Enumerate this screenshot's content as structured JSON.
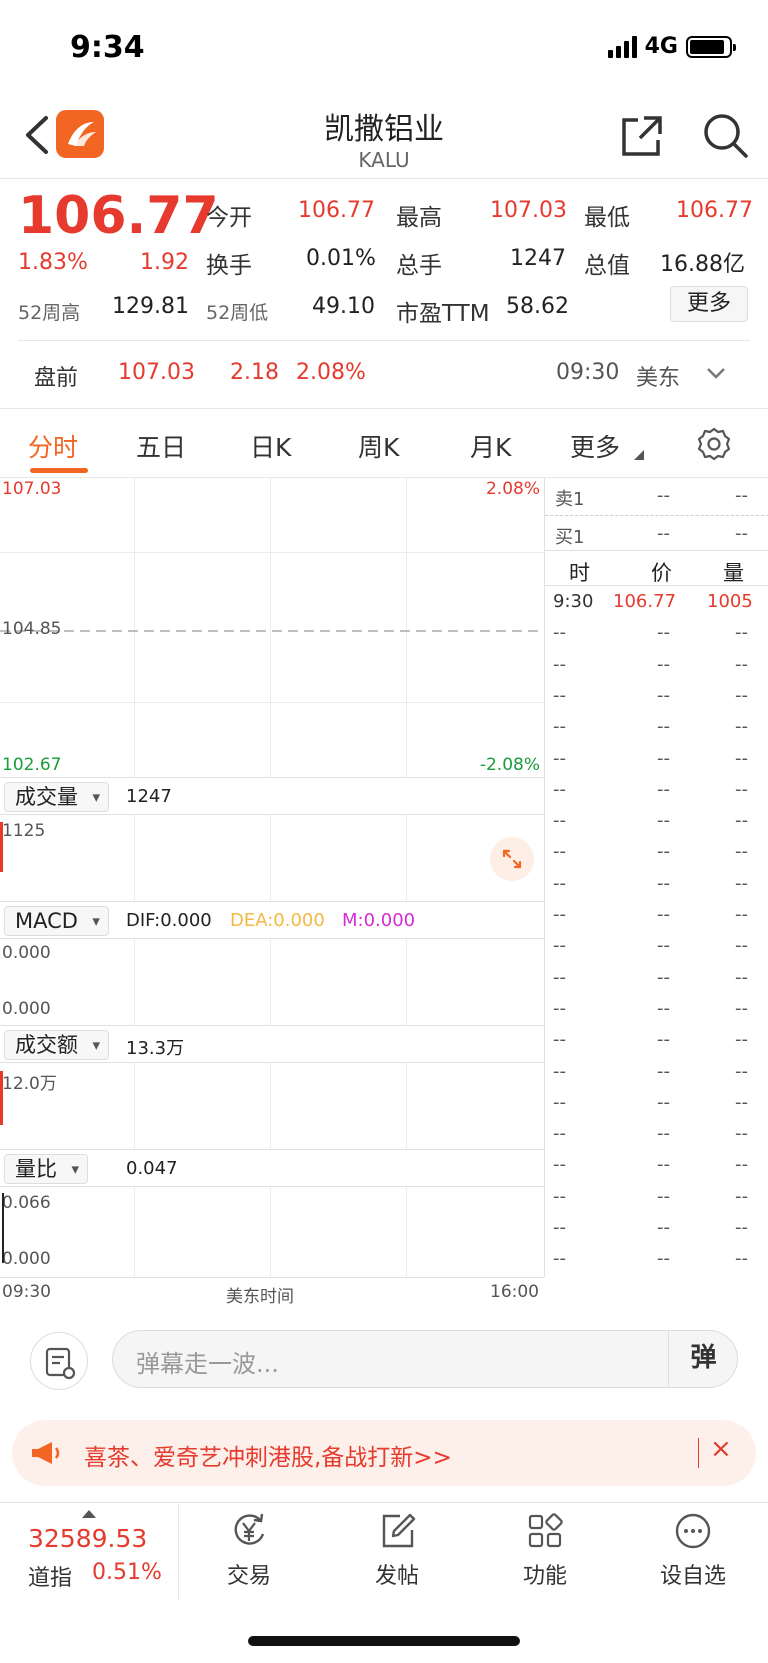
{
  "status": {
    "time": "9:34",
    "network": "4G"
  },
  "header": {
    "title": "凯撒铝业",
    "ticker": "KALU"
  },
  "quote": {
    "price": "106.77",
    "change_pct": "1.83%",
    "change": "1.92",
    "open_label": "今开",
    "open": "106.77",
    "high_label": "最高",
    "high": "107.03",
    "low_label": "最低",
    "low": "106.77",
    "turnover_label": "换手",
    "turnover": "0.01%",
    "volume_label": "总手",
    "volume": "1247",
    "mktcap_label": "总值",
    "mktcap": "16.88亿",
    "w52high_label": "52周高",
    "w52high": "129.81",
    "w52low_label": "52周低",
    "w52low": "49.10",
    "pe_label": "市盈TTM",
    "pe": "58.62",
    "more_label": "更多"
  },
  "premarket": {
    "label": "盘前",
    "price": "107.03",
    "change": "2.18",
    "change_pct": "2.08%",
    "time": "09:30",
    "market": "美东"
  },
  "tabs": [
    {
      "label": "分时",
      "active": true
    },
    {
      "label": "五日"
    },
    {
      "label": "日K"
    },
    {
      "label": "周K"
    },
    {
      "label": "月K"
    },
    {
      "label": "更多"
    }
  ],
  "chart": {
    "price_top": "107.03",
    "pct_top": "2.08%",
    "price_mid": "104.85",
    "price_bottom": "102.67",
    "pct_bottom": "-2.08%",
    "volume_panel": {
      "label": "成交量",
      "value": "1247",
      "axis": "1125"
    },
    "macd_panel": {
      "label": "MACD",
      "dif": "DIF:0.000",
      "dea": "DEA:0.000",
      "m": "M:0.000",
      "axis_top": "0.000",
      "axis_bottom": "0.000"
    },
    "amount_panel": {
      "label": "成交额",
      "value": "13.3万",
      "axis": "12.0万"
    },
    "ratio_panel": {
      "label": "量比",
      "value": "0.047",
      "axis_top": "0.066",
      "axis_bottom": "0.000"
    },
    "time_start": "09:30",
    "time_label": "美东时间",
    "time_end": "16:00",
    "colors": {
      "up": "#e63a2e",
      "down": "#1a9c3b",
      "dea": "#f5b942",
      "m": "#d62bd6"
    }
  },
  "book": {
    "sell1_label": "卖1",
    "sell1_price": "--",
    "sell1_vol": "--",
    "buy1_label": "买1",
    "buy1_price": "--",
    "buy1_vol": "--",
    "headers": {
      "time": "时",
      "price": "价",
      "vol": "量"
    },
    "first_trade": {
      "time": "9:30",
      "price": "106.77",
      "vol": "1005"
    },
    "placeholder": "--"
  },
  "danmu": {
    "placeholder": "弹幕走一波...",
    "button": "弹"
  },
  "banner": {
    "text": "喜茶、爱奇艺冲刺港股,备战打新>>",
    "close": "×"
  },
  "bottom_nav": {
    "index_value": "32589.53",
    "index_name": "道指",
    "index_pct": "0.51%",
    "items": [
      {
        "label": "交易"
      },
      {
        "label": "发帖"
      },
      {
        "label": "功能"
      },
      {
        "label": "设自选"
      }
    ]
  }
}
